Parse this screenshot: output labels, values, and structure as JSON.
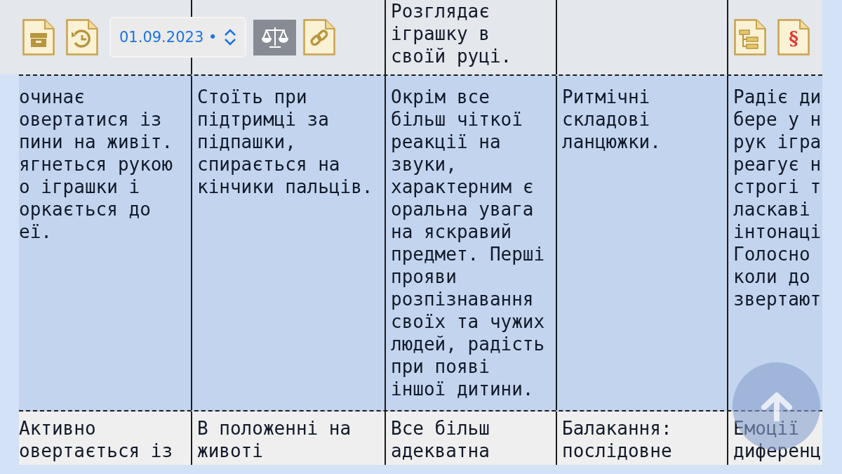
{
  "toolbar": {
    "date_field": "01.09.2023 •",
    "toggle": {
      "on": true
    },
    "section_glyph": "§"
  },
  "rows": [
    {
      "selected": false,
      "cells": [
        {},
        {},
        {
          "text": "Розглядає\nіграшку в\nсвоїй руці."
        },
        {},
        {}
      ]
    },
    {
      "selected": true,
      "cells": [
        {
          "text": "очинає\nовертатися із\nпини на живіт.\nягнеться рукою\nо іграшки і\nоркається до\nеї."
        },
        {
          "text": "Стоїть при\nпідтримці за\nпідпашки,\nспирається на\nкінчики пальців."
        },
        {
          "text": "Окрім все\nбільш чіткої\nреакції на\nзвуки,\nхарактерним є\nоральна увага\nна яскравий\nпредмет. Перші\nпрояви\nрозпізнавання\nсвоїх та чужих\nлюдей, радість\nпри появі\nіншої дитини."
        },
        {
          "text": "Ритмічні\nскладові\nланцюжки."
        },
        {
          "text": "Радіє ди\nбере у н\nрук ігра\nреагує н\nстрогі т\nласкаві\nінтонаці\nГолосно\nколи до\nзвертают"
        }
      ]
    },
    {
      "selected": false,
      "cells": [
        {
          "text": "Активно\nовертається із"
        },
        {
          "text": "В положенні на\nживоті"
        },
        {
          "text": "Все більш\nадекватна"
        },
        {
          "text": "Балакання:\nпослідовне"
        },
        {
          "text": "Емоції\nдиференц"
        }
      ]
    }
  ]
}
